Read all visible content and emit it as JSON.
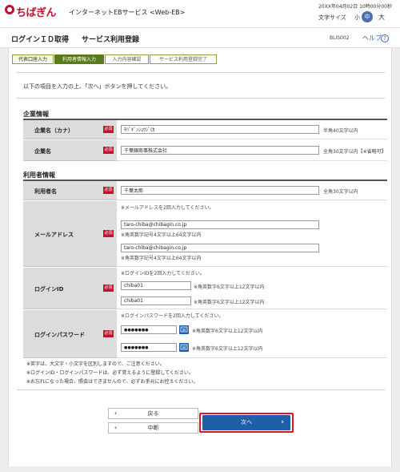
{
  "header": {
    "logo": "ちばぎん",
    "service_name": "インターネットEBサービス <Web-EB>",
    "datetime": "20XX年04月02日 10時00分00秒",
    "font_size_label": "文字サイズ",
    "font_small": "小",
    "font_mid": "中",
    "font_large": "大"
  },
  "titlebar": {
    "title1": "ログインＩＤ取得",
    "title2": "サービス利用登録",
    "screen_code": "BLIS002",
    "help": "ヘルプ",
    "help_icon": "?"
  },
  "steps": [
    "代表口座入力",
    "利用者情報入力",
    "入力内容確認",
    "サービス利用登録完了"
  ],
  "intro": "以下の項目を入力の上、「次へ」ボタンを押してください。",
  "required_label": "必須",
  "company": {
    "section": "企業情報",
    "kana_label": "企業名（カナ）",
    "kana_value": "ﾁﾊﾞｷﾞﾝｼｮｳｼﾞ(ｶ",
    "kana_hint": "半角40文字以内",
    "name_label": "企業名",
    "name_value": "千葉銀商事株式会社",
    "name_hint": "全角30文字以内【※省略可】"
  },
  "user": {
    "section": "利用者情報",
    "name_label": "利用者名",
    "name_value": "千葉太郎",
    "name_hint": "全角30文字以内",
    "email_label": "メールアドレス",
    "email_note": "※メールアドレスを2回入力してください。",
    "email1": "taro-chiba@chibagin.co.jp",
    "email2": "taro-chiba@chibagin.co.jp",
    "email_hint": "※角英数字記号4文字以上64文字以内",
    "id_label": "ログインID",
    "id_note": "※ログインIDを2回入力してください。",
    "id1": "chiba01",
    "id2": "chiba01",
    "id_hint": "※角英数字6文字以上12文字以内",
    "pw_label": "ログインパスワード",
    "pw_note": "※ログインパスワードを2回入力してください。",
    "pw1": "●●●●●●●",
    "pw2": "●●●●●●●",
    "pw_hint": "※角英数字6文字以上12文字以内"
  },
  "notes": [
    "※英字は、大文字・小文字を区別しますので、ご注意ください。",
    "※ログインID・ログインパスワードは、必ず覚えるように登録してください。",
    "※お忘れになった場合、照会はできませんので、必ずお手元にお控えください。"
  ],
  "buttons": {
    "back": "戻る",
    "middle": "中断",
    "next": "次へ"
  }
}
